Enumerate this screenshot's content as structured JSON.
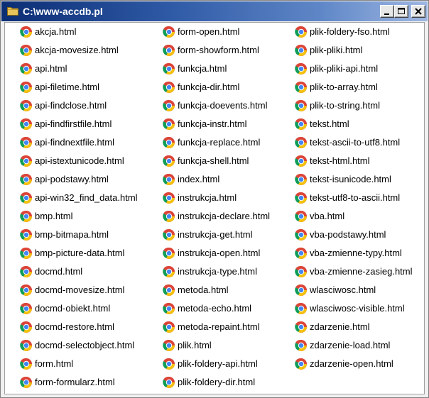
{
  "window": {
    "title": "C:\\www-accdb.pl",
    "accent": "#0b2d74",
    "controls": [
      "minimize",
      "maximize",
      "close"
    ]
  },
  "icons": {
    "folder": "folder-icon",
    "file": "chrome-html-file-icon"
  },
  "files": {
    "col1": [
      "akcja.html",
      "akcja-movesize.html",
      "api.html",
      "api-filetime.html",
      "api-findclose.html",
      "api-findfirstfile.html",
      "api-findnextfile.html",
      "api-istextunicode.html",
      "api-podstawy.html",
      "api-win32_find_data.html",
      "bmp.html",
      "bmp-bitmapa.html",
      "bmp-picture-data.html",
      "docmd.html",
      "docmd-movesize.html",
      "docmd-obiekt.html",
      "docmd-restore.html",
      "docmd-selectobject.html",
      "form.html",
      "form-formularz.html"
    ],
    "col2": [
      "form-open.html",
      "form-showform.html",
      "funkcja.html",
      "funkcja-dir.html",
      "funkcja-doevents.html",
      "funkcja-instr.html",
      "funkcja-replace.html",
      "funkcja-shell.html",
      "index.html",
      "instrukcja.html",
      "instrukcja-declare.html",
      "instrukcja-get.html",
      "instrukcja-open.html",
      "instrukcja-type.html",
      "metoda.html",
      "metoda-echo.html",
      "metoda-repaint.html",
      "plik.html",
      "plik-foldery-api.html",
      "plik-foldery-dir.html"
    ],
    "col3": [
      "plik-foldery-fso.html",
      "plik-pliki.html",
      "plik-pliki-api.html",
      "plik-to-array.html",
      "plik-to-string.html",
      "tekst.html",
      "tekst-ascii-to-utf8.html",
      "tekst-html.html",
      "tekst-isunicode.html",
      "tekst-utf8-to-ascii.html",
      "vba.html",
      "vba-podstawy.html",
      "vba-zmienne-typy.html",
      "vba-zmienne-zasieg.html",
      "wlasciwosc.html",
      "wlasciwosc-visible.html",
      "zdarzenie.html",
      "zdarzenie-load.html",
      "zdarzenie-open.html"
    ]
  }
}
